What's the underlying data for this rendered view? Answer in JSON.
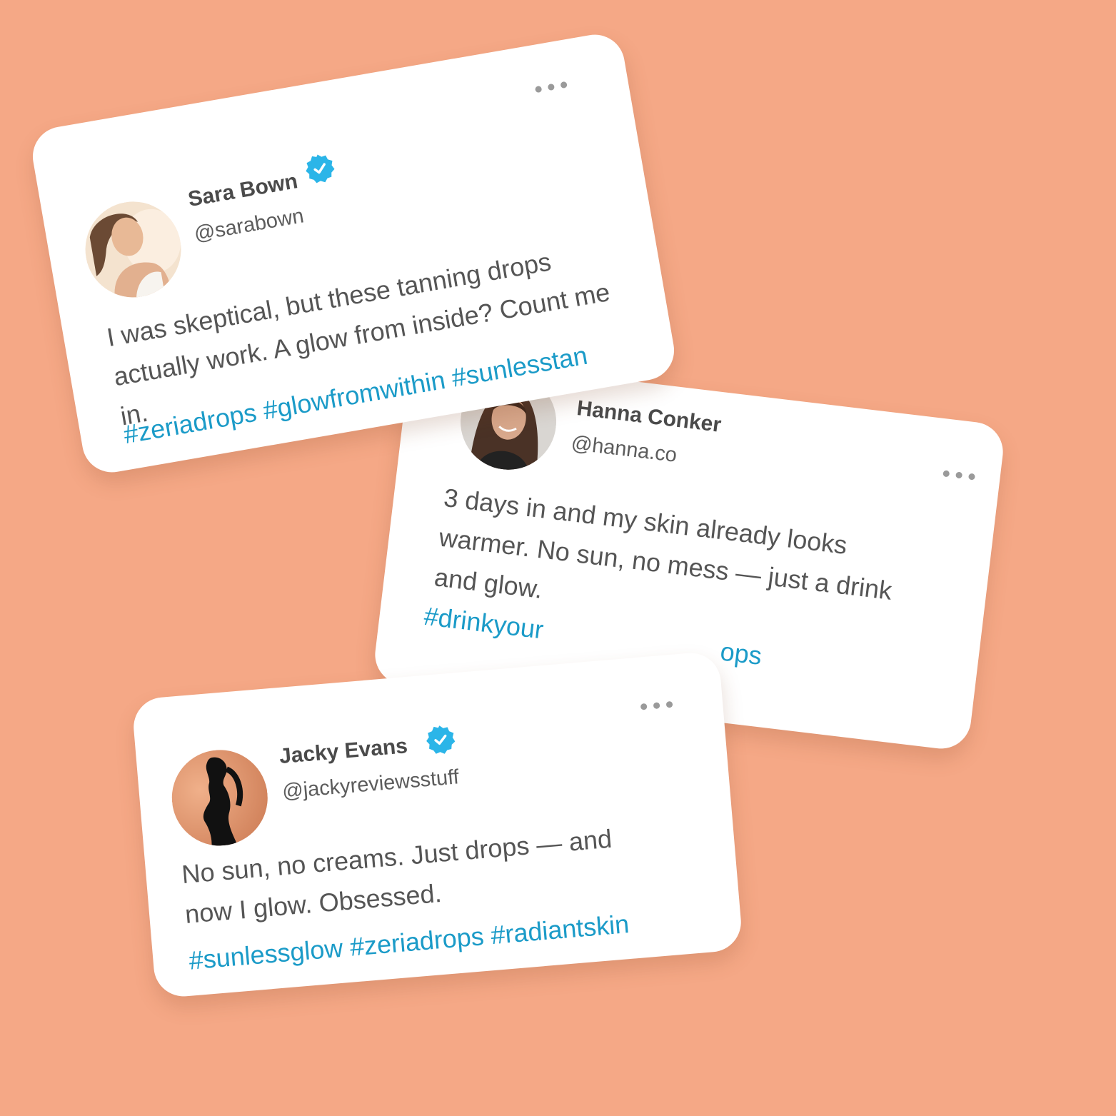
{
  "posts": [
    {
      "name": "Sara Bown",
      "handle": "@sarabown",
      "verified": true,
      "text": "I was skeptical, but these tanning drops actually work. A glow from inside? Count me in.",
      "hashtags": "#zeriadrops #glowfromwithin #sunlesstan"
    },
    {
      "name": "Hanna Conker",
      "handle": "@hanna.co",
      "verified": false,
      "text": "3 days in and my skin already looks warmer. No sun, no mess — just a drink and glow.",
      "hashtags_visible_start": "#drinkyour",
      "hashtags_visible_end": "ops"
    },
    {
      "name": "Jacky Evans",
      "handle": "@jackyreviewsstuff",
      "verified": true,
      "text": "No sun, no creams. Just drops — and now I glow. Obsessed.",
      "hashtags": "#sunlessglow #zeriadrops #radiantskin"
    }
  ],
  "colors": {
    "background": "#f5a886",
    "card": "#ffffff",
    "name": "#4a4a4a",
    "handle": "#5c5c5c",
    "body": "#555555",
    "hashtag": "#1b9bc8",
    "verified": "#2bb5e8"
  },
  "icons": {
    "verified": "verified-badge-icon",
    "more": "more-options-icon"
  }
}
